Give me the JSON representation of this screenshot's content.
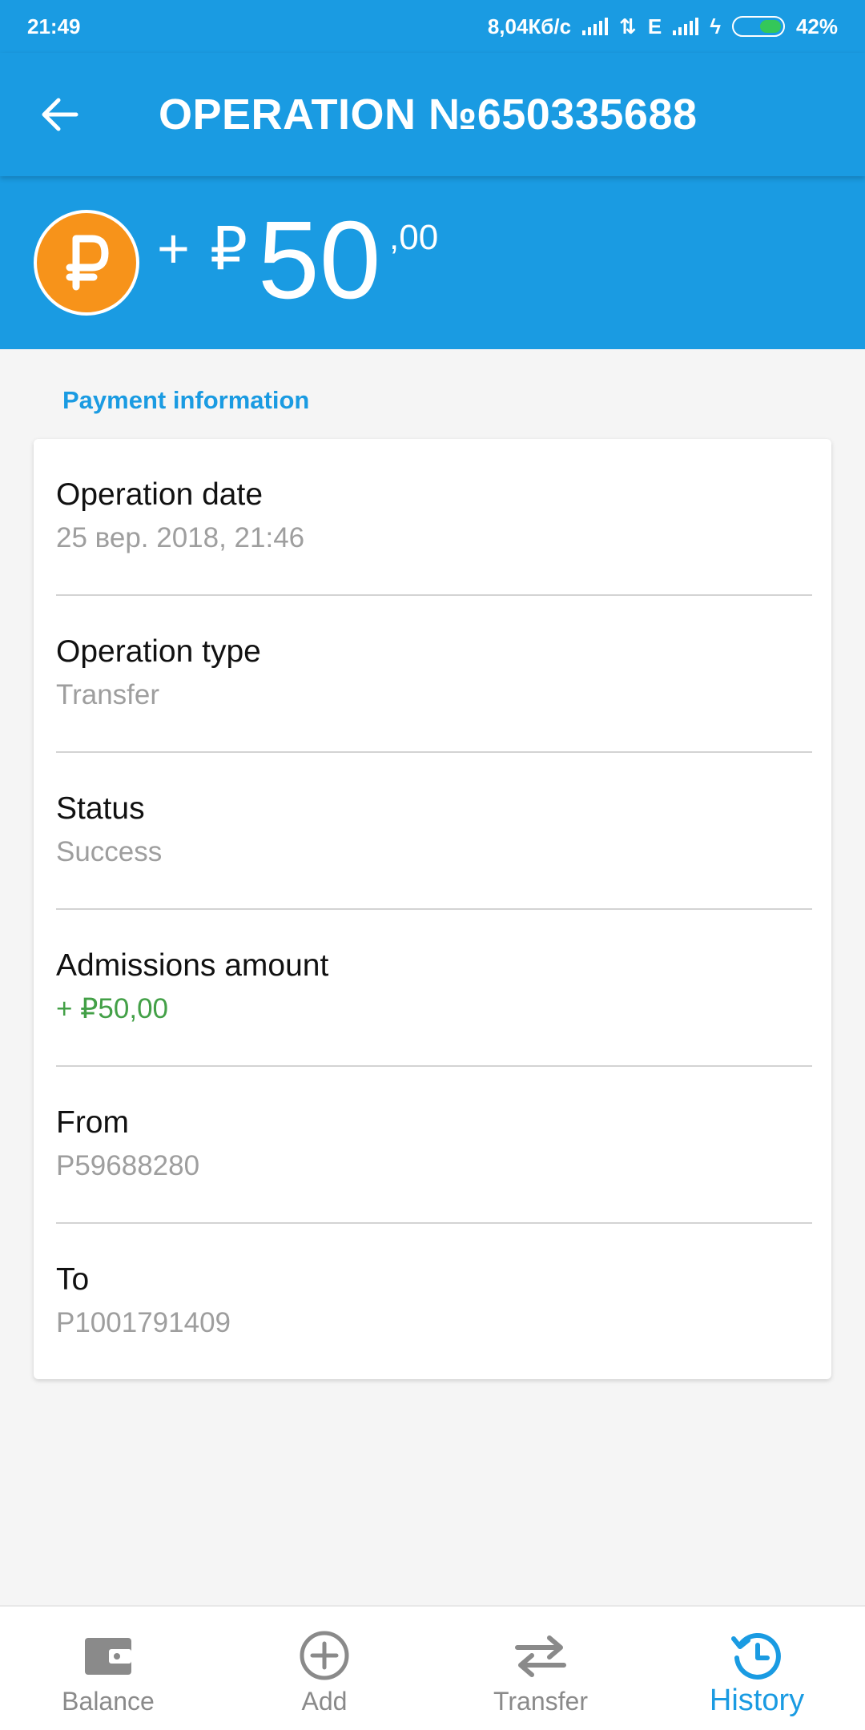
{
  "status_bar": {
    "time": "21:49",
    "network_speed": "8,04Кб/с",
    "network_type": "E",
    "battery": "42%"
  },
  "app_bar": {
    "title": "OPERATION №650335688",
    "back_icon": "arrow-back-icon"
  },
  "amount": {
    "sign": "+",
    "currency": "₽",
    "whole": "50",
    "cents": ",00",
    "coin_icon": "ruble-coin-icon"
  },
  "section": {
    "title": "Payment information"
  },
  "details": [
    {
      "label": "Operation date",
      "value": "25 вер. 2018, 21:46",
      "positive": false
    },
    {
      "label": "Operation type",
      "value": "Transfer",
      "positive": false
    },
    {
      "label": "Status",
      "value": "Success",
      "positive": false
    },
    {
      "label": "Admissions amount",
      "value": "+ ₽50,00",
      "positive": true
    },
    {
      "label": "From",
      "value": "P59688280",
      "positive": false
    },
    {
      "label": "To",
      "value": "P1001791409",
      "positive": false
    }
  ],
  "bottom_nav": [
    {
      "label": "Balance",
      "icon": "wallet-icon",
      "active": false
    },
    {
      "label": "Add",
      "icon": "add-circle-icon",
      "active": false
    },
    {
      "label": "Transfer",
      "icon": "transfer-arrows-icon",
      "active": false
    },
    {
      "label": "History",
      "icon": "history-icon",
      "active": true
    }
  ],
  "colors": {
    "primary": "#1a9be2",
    "coin": "#f7931a",
    "positive": "#43a047",
    "inactive": "#8a8a8a"
  }
}
